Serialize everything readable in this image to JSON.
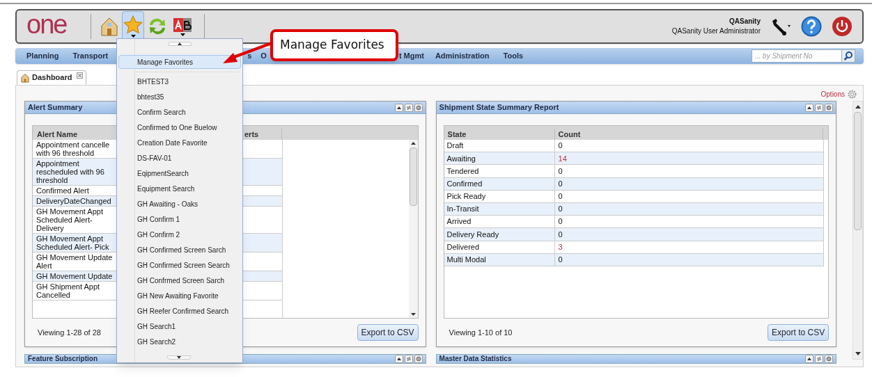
{
  "header": {
    "logo": "one",
    "user_name": "QASanity",
    "user_role": "QASanity User Administrator"
  },
  "nav": {
    "items": [
      {
        "label": "Planning"
      },
      {
        "label": "Transport"
      },
      {
        "label": "s"
      },
      {
        "label": "O"
      },
      {
        "label": "t Mgmt"
      },
      {
        "label": "Administration"
      },
      {
        "label": "Tools"
      }
    ],
    "search": {
      "placeholder": "... by Shipment No"
    }
  },
  "tabs": [
    {
      "label": "Dashboard",
      "selected": true
    }
  ],
  "options_link": "Options",
  "favorites_menu": {
    "items": [
      {
        "label": "Manage Favorites",
        "selected": true
      },
      {
        "label": "BHTEST3",
        "selected": false
      },
      {
        "label": "bhtest35",
        "selected": false
      },
      {
        "label": "Confirm Search",
        "selected": false
      },
      {
        "label": "Confirmed to One Buelow",
        "selected": false
      },
      {
        "label": "Creation Date Favorite",
        "selected": false
      },
      {
        "label": "DS-FAV-01",
        "selected": false
      },
      {
        "label": "EqipmentSearch",
        "selected": false
      },
      {
        "label": "Equipment Search",
        "selected": false
      },
      {
        "label": "GH Awaiting - Oaks",
        "selected": false
      },
      {
        "label": "GH Confirm 1",
        "selected": false
      },
      {
        "label": "GH Confirm 2",
        "selected": false
      },
      {
        "label": "GH Confirmed Screen Sarch",
        "selected": false
      },
      {
        "label": "GH Confirmed Screen Search",
        "selected": false
      },
      {
        "label": "GH Confrmed Screen Sarch",
        "selected": false
      },
      {
        "label": "GH New Awaiting Favorite",
        "selected": false
      },
      {
        "label": "GH Reefer Confirmed Search",
        "selected": false
      },
      {
        "label": "GH Search1",
        "selected": false
      },
      {
        "label": "GH Search2",
        "selected": false
      }
    ]
  },
  "callout": "Manage Favorites",
  "alert_summary": {
    "title": "Alert Summary",
    "columns": [
      "Alert Name",
      "erts"
    ],
    "rows": [
      {
        "name": "Appointment cancelle\nwith 96 threshold"
      },
      {
        "name": "Appointment\nrescheduled with 96\nthreshold"
      },
      {
        "name": "Confirmed Alert"
      },
      {
        "name": "DeliveryDateChanged"
      },
      {
        "name": "GH Movement Appt\nScheduled Alert-\nDelivery"
      },
      {
        "name": "GH Movement Appt\nScheduled Alert- Pick"
      },
      {
        "name": "GH Movement Update\nAlert"
      },
      {
        "name": "GH Movement Update"
      },
      {
        "name": "GH Shipment Appt\nCancelled"
      }
    ],
    "footer": "Viewing 1-28 of 28",
    "export_button": "Export to CSV"
  },
  "shipment_state": {
    "title": "Shipment State Summary Report",
    "columns": [
      "State",
      "Count"
    ],
    "rows": [
      {
        "state": "Draft",
        "count": "0",
        "highlight": false
      },
      {
        "state": "Awaiting",
        "count": "14",
        "highlight": true
      },
      {
        "state": "Tendered",
        "count": "0",
        "highlight": false
      },
      {
        "state": "Confirmed",
        "count": "0",
        "highlight": false
      },
      {
        "state": "Pick Ready",
        "count": "0",
        "highlight": false
      },
      {
        "state": "In-Transit",
        "count": "0",
        "highlight": false
      },
      {
        "state": "Arrived",
        "count": "0",
        "highlight": false
      },
      {
        "state": "Delivery Ready",
        "count": "0",
        "highlight": false
      },
      {
        "state": "Delivered",
        "count": "3",
        "highlight": true
      },
      {
        "state": "Multi Modal",
        "count": "0",
        "highlight": false
      }
    ],
    "footer": "Viewing 1-10 of 10",
    "export_button": "Export to CSV"
  },
  "lower_portlets": [
    "Feature Subscription",
    "Master Data Statistics"
  ]
}
